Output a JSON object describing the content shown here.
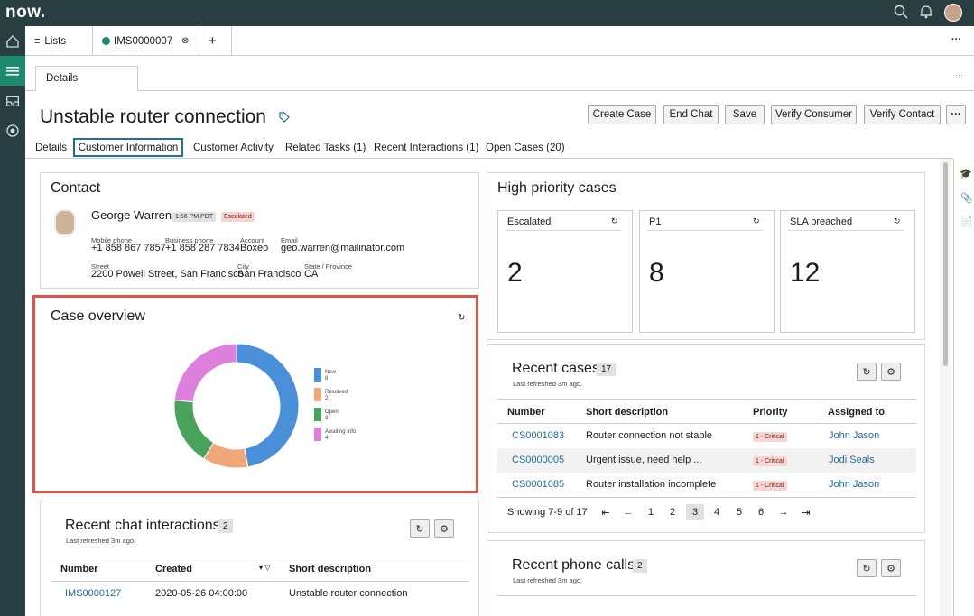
{
  "topbar": {
    "logo": "now.",
    "search_icon": "search-icon",
    "bell_icon": "bell-icon"
  },
  "tabs": {
    "lists": "Lists",
    "case": "IMS0000007",
    "add": "+",
    "more": "···"
  },
  "subtab": {
    "details": "Details",
    "more": "···"
  },
  "page": {
    "title": "Unstable router connection"
  },
  "actions": [
    "Create Case",
    "End Chat",
    "Save",
    "Verify Consumer",
    "Verify Contact"
  ],
  "actions_more": "···",
  "content_tabs": [
    "Details",
    "Customer Information",
    "Customer Activity",
    "Related Tasks (1)",
    "Recent Interactions (1)",
    "Open Cases (20)"
  ],
  "contact": {
    "title": "Contact",
    "name": "George Warren",
    "time": "1:56 PM PDT",
    "status": "Escalated",
    "mobile_label": "Mobile phone",
    "mobile": "+1 858 867 7857",
    "business_label": "Business phone",
    "business": "+1 858 287 7834",
    "account_label": "Account",
    "account": "Boxeo",
    "email_label": "Email",
    "email": "geo.warren@mailinator.com",
    "street_label": "Street",
    "street": "2200 Powell Street, San Francisco",
    "city_label": "City",
    "city": "San Francisco",
    "state_label": "State / Province",
    "state": "CA"
  },
  "case_overview": {
    "title": "Case overview"
  },
  "chart_data": {
    "type": "pie",
    "categories": [
      "New",
      "Resolved",
      "Open",
      "Awaiting Info"
    ],
    "values": [
      8,
      2,
      3,
      4
    ],
    "colors": [
      "#4a90d9",
      "#f0a87a",
      "#4aa35a",
      "#dd7fdc"
    ],
    "legend": "right"
  },
  "high_priority": {
    "title": "High priority cases",
    "tiles": [
      {
        "label": "Escalated",
        "value": "2"
      },
      {
        "label": "P1",
        "value": "8"
      },
      {
        "label": "SLA breached",
        "value": "12"
      }
    ]
  },
  "recent_cases": {
    "title": "Recent cases",
    "count": "17",
    "refreshed": "Last refreshed 3m ago.",
    "headers": [
      "Number",
      "Short description",
      "Priority",
      "Assigned to"
    ],
    "rows": [
      {
        "number": "CS0001083",
        "desc": "Router connection not stable",
        "priority": "1 - Critical",
        "assigned": "John Jason"
      },
      {
        "number": "CS0000005",
        "desc": "Urgent issue, need help ...",
        "priority": "1 - Critical",
        "assigned": "Jodi Seals"
      },
      {
        "number": "CS0001085",
        "desc": "Router installation incomplete",
        "priority": "1 - Critical",
        "assigned": "John Jason"
      }
    ],
    "showing": "Showing 7-9 of 17",
    "pages": [
      "1",
      "2",
      "3",
      "4",
      "5",
      "6"
    ]
  },
  "recent_chat": {
    "title": "Recent chat interactions",
    "count": "2",
    "refreshed": "Last refreshed 3m ago.",
    "headers": [
      "Number",
      "Created",
      "Short description"
    ],
    "row": {
      "number": "IMS0000127",
      "created": "2020-05-26 04:00:00",
      "desc": "Unstable router connection"
    }
  },
  "recent_calls": {
    "title": "Recent phone calls",
    "count": "2",
    "refreshed": "Last refreshed 3m ago."
  }
}
